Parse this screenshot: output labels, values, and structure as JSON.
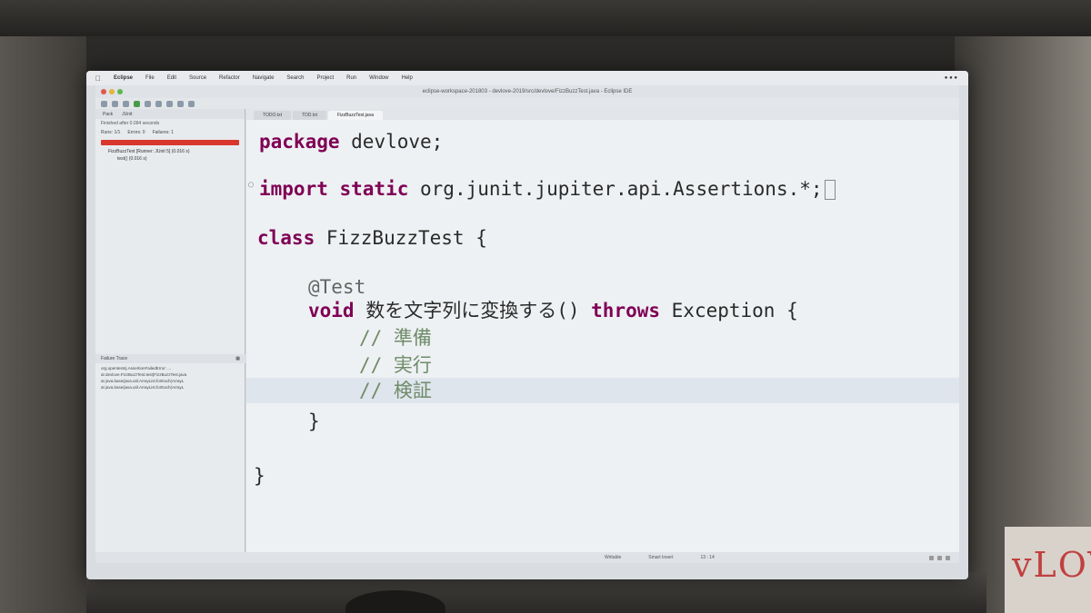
{
  "menubar": {
    "app_name": "Eclipse",
    "items": [
      "File",
      "Edit",
      "Source",
      "Refactor",
      "Navigate",
      "Search",
      "Project",
      "Run",
      "Window",
      "Help"
    ]
  },
  "window": {
    "title": "eclipse-workspace-201803 - devlove-2019/src/devlove/FizzBuzzTest.java - Eclipse IDE"
  },
  "left_panel": {
    "tabs": [
      "Pack",
      "JUnit"
    ],
    "info": "Finished after 0.094 seconds",
    "counters": {
      "runs": "Runs: 1/1",
      "errors": "Errors: 0",
      "failures": "Failures: 1"
    },
    "tree": [
      {
        "label": "FizzBuzzTest [Runner: JUnit 5] (0.016 s)"
      },
      {
        "label": "test() (0.016 s)"
      }
    ],
    "trace_title": "Failure Trace",
    "trace_lines": [
      "org.opentest4j.AssertionFailedError: ...",
      "at devlove.FizzBuzzTest.test(FizzBuzzTest.java",
      "at java.base/java.util.ArrayList.forEach(ArrayL",
      "at java.base/java.util.ArrayList.forEach(ArrayL"
    ]
  },
  "editor_tabs": [
    "TODO.txt",
    "TDD.txt",
    "FizzBuzzTest.java"
  ],
  "code": {
    "line1_kw": "package",
    "line1_rest": " devlove;",
    "line2_kw": "import static",
    "line2_rest": " org.junit.jupiter.api.Assertions.*;",
    "line3_kw": "class",
    "line3_rest": " FizzBuzzTest {",
    "line4_ann": "@Test",
    "line5_kw1": "void",
    "line5_mid": " 数を文字列に変換する() ",
    "line5_kw2": "throws",
    "line5_rest": " Exception {",
    "line6_cmt": "// 準備",
    "line7_cmt": "// 実行",
    "line8_cmt": "// 検証",
    "line9": "}",
    "line10": "}"
  },
  "statusbar": {
    "mode": "Writable",
    "insert": "Smart Insert",
    "position": "13 : 14"
  },
  "room": {
    "sign_text": "vLOV"
  }
}
